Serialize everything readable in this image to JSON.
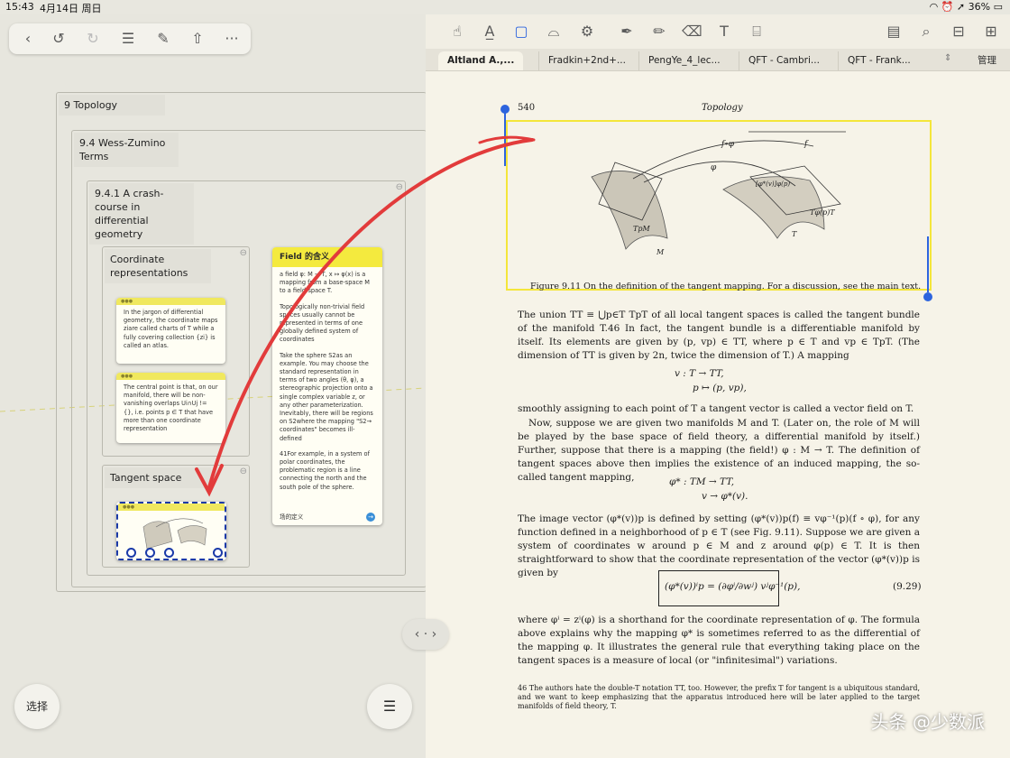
{
  "status_bar": {
    "time": "15:43",
    "date": "4月14日 周日",
    "battery": "36%"
  },
  "left_pane": {
    "toolbar": {
      "icons": [
        "back-icon",
        "undo-icon",
        "redo-icon",
        "list-icon",
        "edit-icon",
        "share-icon",
        "more-icon"
      ]
    },
    "frames": {
      "topology": "9 Topology",
      "wess_zumino": "9.4 Wess-Zumino Terms",
      "crash_course": "9.4.1 A crash-course in differential geometry",
      "coordinate": "Coordinate representations",
      "tangent": "Tangent space"
    },
    "cards": {
      "coord1": "In the jargon of differential geometry, the coordinate maps ziare called charts of T while a fully covering collection {zi} is called an atlas.",
      "coord2": "The central point is that, on our manifold, there will be non-vanishing overlaps Ui∩Uj != {}, i.e. points p ∈ T that have more than one coordinate representation",
      "field_title": "Field 的含义",
      "field_p1": "a field φ: M → T, x ↦ φ(x) is a mapping from a base-space M to a field-space T.",
      "field_p2": "Topologically non-trivial field spaces usually cannot be represented in terms of one globally defined system of coordinates",
      "field_p3": "Take the sphere S2as an example. You may choose the standard representation in terms of two angles (θ, φ), a stereographic projection onto a single complex variable z, or any other parameterization. Inevitably, there will be regions on S2where the mapping \"S2→ coordinates\" becomes ill-defined",
      "field_p4": "41For example, in a system of polar coordinates, the problematic region is a line connecting the north and the south pole of the sphere.",
      "field_footer": "场的定义"
    },
    "select_button": "选择"
  },
  "right_pane": {
    "toolbar_icons": [
      "hand-icon",
      "highlight-text-icon",
      "rect-select-icon",
      "lasso-icon",
      "shape-icon",
      "pen-icon",
      "highlighter-icon",
      "eraser-icon",
      "textbox-icon",
      "text-select-icon",
      "doc-icon",
      "search-icon",
      "bookmark-icon",
      "grid-icon"
    ],
    "tabs": [
      "Altland A.,...",
      "Fradkin+2nd+...",
      "PengYe_4_lec...",
      "QFT - Cambri...",
      "QFT - Frank..."
    ],
    "manage": "管理",
    "page": {
      "number": "540",
      "header": "Topology",
      "caption": "Figure 9.11  On the definition of the tangent mapping. For a discussion, see the main text.",
      "para1": "The union TT ≡ ⋃p∈T TpT of all local tangent spaces is called the tangent bundle of the manifold T.46 In fact, the tangent bundle is a differentiable manifold by itself. Its elements are given by (p, vp) ∈ TT, where p ∈ T and vp ∈ TpT. (The dimension of TT is given by 2n, twice the dimension of T.) A mapping",
      "eq1_l1": "v : T   →   TT,",
      "eq1_l2": "p   ↦   (p, vp),",
      "para2": "smoothly assigning to each point of T a tangent vector is called a vector field on T.",
      "para3": "Now, suppose we are given two manifolds M and T. (Later on, the role of M will be played by the base space of field theory, a differential manifold by itself.) Further, suppose that there is a mapping (the field!) φ : M → T. The definition of tangent spaces above then implies the existence of an induced mapping, the so-called tangent mapping,",
      "eq2_l1": "φ* : TM   →   TT,",
      "eq2_l2": "v   →   φ*(v).",
      "para4": "The image vector (φ*(v))p is defined by setting (φ*(v))p(f) ≡ vφ⁻¹(p)(f ∘ φ), for any function defined in a neighborhood of p ∈ T (see Fig. 9.11). Suppose we are given a system of coordinates w around p ∈ M and z around φ(p) ∈ T. It is then straightforward to show that the coordinate representation of the vector (φ*(v))p is given by",
      "eq3": "(φ*(v))ⁱp = (∂φⁱ/∂wʲ) vʲφ⁻¹(p),",
      "eq3_num": "(9.29)",
      "para5": "where φⁱ = zⁱ(φ) is a shorthand for the coordinate representation of φ. The formula above explains why the mapping φ* is sometimes referred to as the differential of the mapping φ. It illustrates the general rule that everything taking place on the tangent spaces is a measure of local (or \"infinitesimal\") variations.",
      "footnote": "46 The authors hate the double-T notation TT, too. However, the prefix T for tangent is a ubiquitous standard, and we want to keep emphasizing that the apparatus introduced here will be later applied to the target manifolds of field theory, T."
    }
  },
  "watermark": "头条 @少数派",
  "colors": {
    "accent": "#2d64de",
    "card_yellow": "#f0e85e",
    "arrow_red": "#e23b3b"
  }
}
